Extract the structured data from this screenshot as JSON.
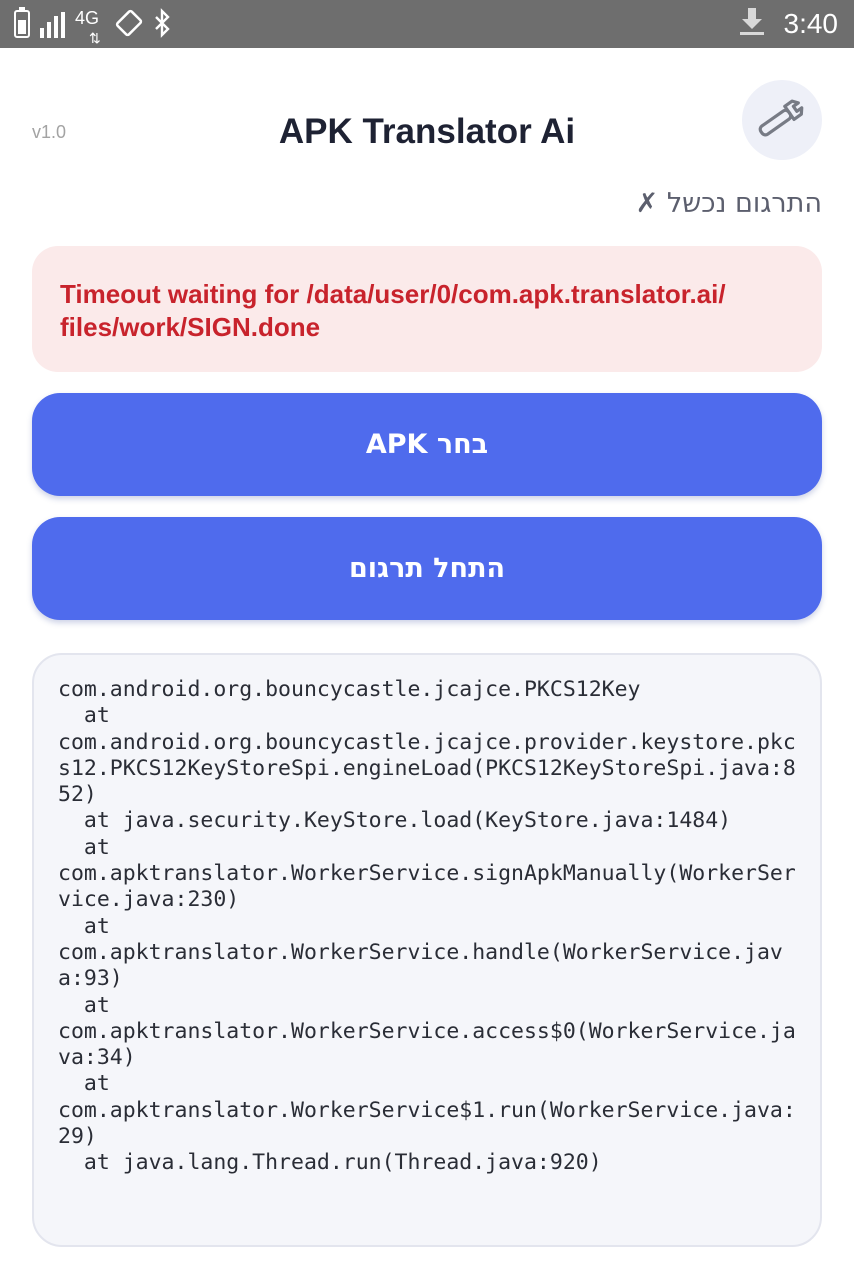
{
  "status_bar": {
    "network_type": "4G",
    "data_arrows": "⇅",
    "rotate_icon": "rotate-icon",
    "bluetooth_icon": "bluetooth-icon",
    "download_icon": "download-icon",
    "time": "3:40"
  },
  "header": {
    "version": "v1.0",
    "title": "APK Translator Ai",
    "settings_icon": "wrench-icon"
  },
  "status_message": "התרגום נכשל ✗",
  "error": {
    "message": "Timeout waiting for /data/user/0/com.apk.translator.ai/ files/work/SIGN.done"
  },
  "buttons": {
    "pick_apk": "בחר APK",
    "start_translation": "התחל תרגום"
  },
  "log": {
    "text": "com.android.org.bouncycastle.jcajce.PKCS12Key\n  at\ncom.android.org.bouncycastle.jcajce.provider.keystore.pkcs12.PKCS12KeyStoreSpi.engineLoad(PKCS12KeyStoreSpi.java:852)\n  at java.security.KeyStore.load(KeyStore.java:1484)\n  at\ncom.apktranslator.WorkerService.signApkManually(WorkerService.java:230)\n  at\ncom.apktranslator.WorkerService.handle(WorkerService.java:93)\n  at\ncom.apktranslator.WorkerService.access$0(WorkerService.java:34)\n  at\ncom.apktranslator.WorkerService$1.run(WorkerService.java:29)\n  at java.lang.Thread.run(Thread.java:920)"
  },
  "colors": {
    "primary": "#4f6bed",
    "error_bg": "#fbeaea",
    "error_text": "#c8232c",
    "status_bar": "#6e6e6e"
  }
}
